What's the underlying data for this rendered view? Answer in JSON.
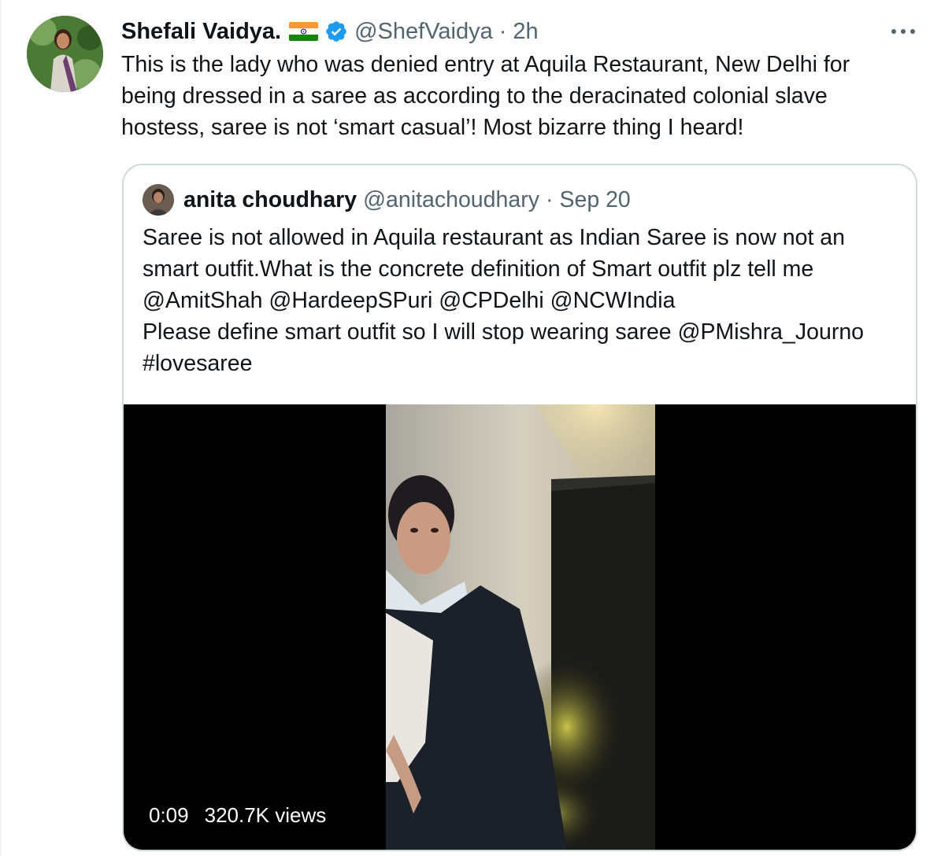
{
  "author": {
    "display_name": "Shefali Vaidya.",
    "handle": "@ShefVaidya",
    "separator": "·",
    "time": "2h",
    "flag": "india-flag",
    "verified_icon": "verified-badge-icon"
  },
  "tweet_text": "This is the lady who was denied entry at Aquila Restaurant, New Delhi for being dressed in a saree as according to the deracinated colonial slave hostess, saree is not ‘smart casual’! Most bizarre thing I heard!",
  "quoted": {
    "display_name": "anita choudhary",
    "handle": "@anitachoudhary",
    "separator": "·",
    "date": "Sep 20",
    "lines": [
      "Saree is not allowed in Aquila restaurant as Indian Saree is now not an",
      "smart outfit.What is the concrete definition of Smart outfit plz tell me",
      "@AmitShah @HardeepSPuri @CPDelhi @NCWIndia",
      "Please define smart outfit so I will stop wearing saree @PMishra_Journo",
      "#lovesaree"
    ],
    "video": {
      "duration": "0:09",
      "views": "320.7K views"
    }
  },
  "colors": {
    "text": "#0f1419",
    "secondary": "#536471",
    "verified": "#1d9bf0",
    "border": "#cfd9de"
  }
}
